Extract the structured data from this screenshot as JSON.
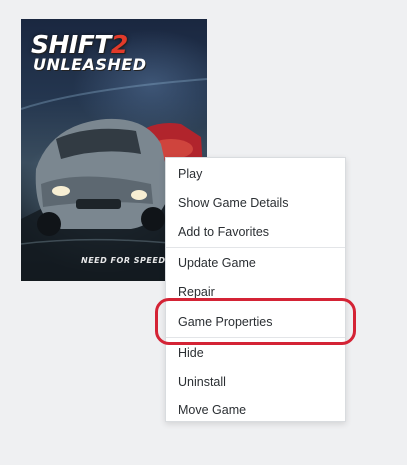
{
  "cover": {
    "title": "SHIFT",
    "title_number": "2",
    "subtitle": "UNLEASHED",
    "logo": "NEED FOR SPEED"
  },
  "context_menu": {
    "items": [
      {
        "label": "Play"
      },
      {
        "label": "Show Game Details"
      },
      {
        "label": "Add to Favorites"
      },
      {
        "label": "Update Game"
      },
      {
        "label": "Repair"
      },
      {
        "label": "Game Properties"
      },
      {
        "label": "Hide"
      },
      {
        "label": "Uninstall"
      },
      {
        "label": "Move Game"
      }
    ],
    "highlighted_item": "Game Properties"
  },
  "colors": {
    "background": "#eff0f2",
    "menu_background": "#ffffff",
    "menu_text": "#2b2f33",
    "highlight_ring": "#d42335",
    "title_accent": "#e23a2a"
  }
}
